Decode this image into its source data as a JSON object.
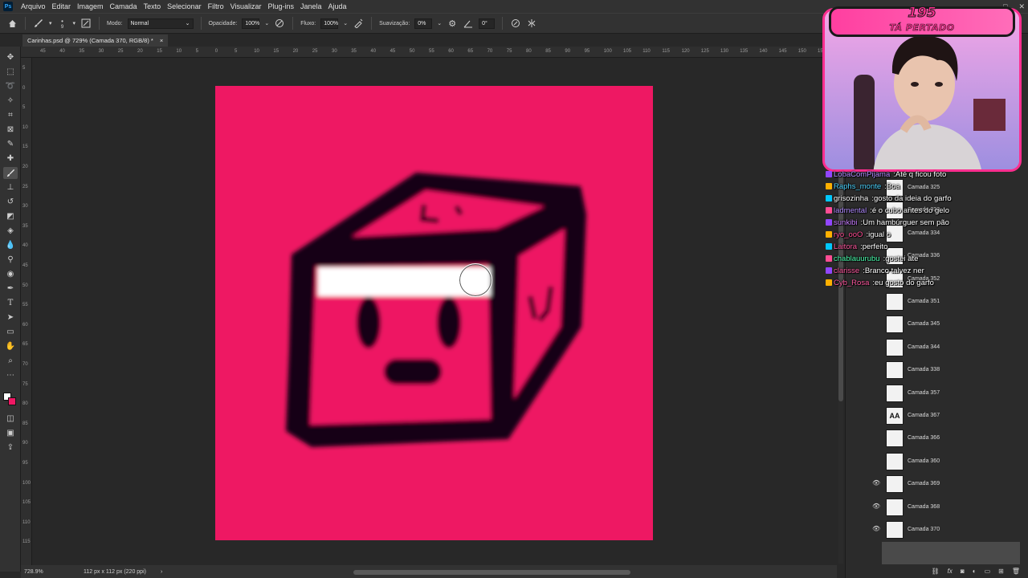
{
  "menubar": {
    "app_icon": "Ps",
    "items": [
      "Arquivo",
      "Editar",
      "Imagem",
      "Camada",
      "Texto",
      "Selecionar",
      "Filtro",
      "Visualizar",
      "Plug-ins",
      "Janela",
      "Ajuda"
    ],
    "window_controls": [
      "—",
      "□",
      "✕"
    ]
  },
  "options": {
    "mode_label": "Modo:",
    "mode_value": "Normal",
    "opacity_label": "Opacidade:",
    "opacity_value": "100%",
    "flow_label": "Fluxo:",
    "flow_value": "100%",
    "smoothing_label": "Suavização:",
    "smoothing_value": "0%",
    "angle_value": "0°",
    "brush_size": "9"
  },
  "document": {
    "tab_title": "Carinhas.psd @ 729% (Camada 370, RGB/8) *",
    "close": "×"
  },
  "ruler_h_labels": [
    "45",
    "40",
    "35",
    "30",
    "25",
    "20",
    "15",
    "10",
    "5",
    "0",
    "5",
    "10",
    "15",
    "20",
    "25",
    "30",
    "35",
    "40",
    "45",
    "50",
    "55",
    "60",
    "65",
    "70",
    "75",
    "80",
    "85",
    "90",
    "95",
    "100",
    "105",
    "110",
    "115",
    "120",
    "125",
    "130",
    "135",
    "140",
    "145",
    "150",
    "155"
  ],
  "ruler_v_labels": [
    "5",
    "0",
    "5",
    "10",
    "15",
    "20",
    "25",
    "30",
    "35",
    "40",
    "45",
    "50",
    "55",
    "60",
    "65",
    "70",
    "75",
    "80",
    "85",
    "90",
    "95",
    "100",
    "105",
    "110",
    "115"
  ],
  "status": {
    "zoom": "728.9%",
    "doc_size": "112 px x 112 px (220 ppi)"
  },
  "colors": {
    "canvas": "#ee1863",
    "foreground": "#ffffff",
    "background": "#ee1863"
  },
  "webcam": {
    "counter": "195",
    "caption": "TÁ PERTADO"
  },
  "chat": [
    {
      "user": "LobaComPijama",
      "msg": "Até q ficou foto",
      "color": "#b28cff"
    },
    {
      "user": "Raphs_monte",
      "msg": "Boa",
      "color": "#4dd4ff"
    },
    {
      "user": "grisozinha",
      "msg": "gosto da ideia do garfo",
      "color": "#ffffff"
    },
    {
      "user": "ladmental",
      "msg": "é o cubo antes do gelo",
      "color": "#b28cff"
    },
    {
      "user": "sunkibi",
      "msg": "Um hambúrguer sem pão",
      "color": "#c77dff"
    },
    {
      "user": "ryo_ooO",
      "msg": "igual o",
      "color": "#ff4d94"
    },
    {
      "user": "Laitora",
      "msg": "perfeito",
      "color": "#ff5aa0"
    },
    {
      "user": "chablauurubu",
      "msg": "gostei ate",
      "color": "#4dffb0"
    },
    {
      "user": "clarisse",
      "msg": "Branco talvez ner",
      "color": "#ff5aa0"
    },
    {
      "user": "Cyb_Rosa",
      "msg": "eu gosto do garfo",
      "color": "#ff5aa0"
    }
  ],
  "layers": [
    {
      "name": "Camada 325",
      "thumb": "",
      "visible": false
    },
    {
      "name": "Camada 333",
      "thumb": "",
      "visible": false
    },
    {
      "name": "Camada 334",
      "thumb": "",
      "visible": false
    },
    {
      "name": "Camada 336",
      "thumb": "",
      "visible": false
    },
    {
      "name": "Camada 352",
      "thumb": "",
      "visible": false
    },
    {
      "name": "Camada 351",
      "thumb": "",
      "visible": false
    },
    {
      "name": "Camada 345",
      "thumb": "",
      "visible": false
    },
    {
      "name": "Camada 344",
      "thumb": "",
      "visible": false
    },
    {
      "name": "Camada 338",
      "thumb": "",
      "visible": false
    },
    {
      "name": "Camada 357",
      "thumb": "",
      "visible": false
    },
    {
      "name": "Camada 367",
      "thumb": "AA",
      "visible": false
    },
    {
      "name": "Camada 366",
      "thumb": "",
      "visible": false
    },
    {
      "name": "Camada 360",
      "thumb": "",
      "visible": false
    },
    {
      "name": "Camada 369",
      "thumb": "",
      "visible": true
    },
    {
      "name": "Camada 368",
      "thumb": "",
      "visible": true
    },
    {
      "name": "Camada 370",
      "thumb": "",
      "visible": true
    }
  ],
  "icons": {
    "eye": "👁",
    "footer": [
      "link-icon",
      "fx-icon",
      "mask-icon",
      "adjustment-icon",
      "group-icon",
      "new-layer-icon",
      "trash-icon"
    ]
  }
}
